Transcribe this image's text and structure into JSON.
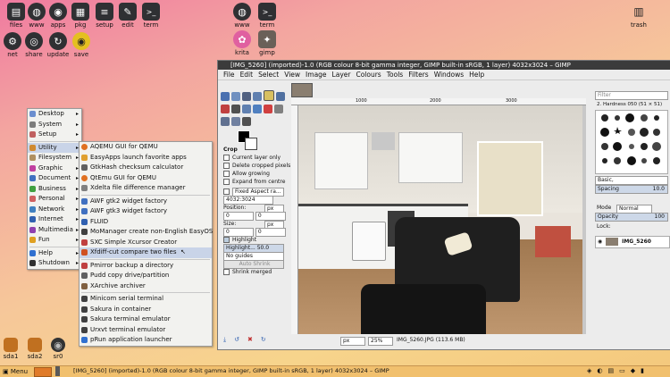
{
  "desktop_icons_top": [
    {
      "label": "files",
      "icon": "files-icon",
      "glyph": "▤"
    },
    {
      "label": "www",
      "icon": "globe-icon",
      "glyph": "◍"
    },
    {
      "label": "apps",
      "icon": "apps-icon",
      "glyph": "◉"
    },
    {
      "label": "pkg",
      "icon": "package-icon",
      "glyph": "▦"
    },
    {
      "label": "setup",
      "icon": "sliders-icon",
      "glyph": "≡"
    },
    {
      "label": "edit",
      "icon": "edit-icon",
      "glyph": "✎"
    },
    {
      "label": "term",
      "icon": "terminal-icon",
      "glyph": ">_"
    }
  ],
  "desktop_icons_row2": [
    {
      "label": "net",
      "icon": "network-icon",
      "glyph": "⚙"
    },
    {
      "label": "share",
      "icon": "share-icon",
      "glyph": "◎"
    },
    {
      "label": "update",
      "icon": "update-icon",
      "glyph": "↻"
    },
    {
      "label": "save",
      "icon": "save-icon",
      "glyph": "◉"
    }
  ],
  "desktop_icons_center": [
    {
      "label": "www",
      "icon": "globe-icon",
      "glyph": "◍"
    },
    {
      "label": "term",
      "icon": "terminal-icon",
      "glyph": ">_"
    },
    {
      "label": "krita",
      "icon": "krita-icon",
      "glyph": "✿"
    },
    {
      "label": "gimp",
      "icon": "gimp-icon",
      "glyph": "✦"
    }
  ],
  "trash": {
    "label": "trash",
    "icon": "trash-icon",
    "glyph": "🗑"
  },
  "drives": [
    {
      "label": "sda1",
      "icon": "drive-icon"
    },
    {
      "label": "sda2",
      "icon": "drive-icon"
    },
    {
      "label": "sr0",
      "icon": "optical-drive-icon"
    }
  ],
  "main_menu": {
    "items": [
      {
        "label": "Desktop",
        "color": "#6b8ecf",
        "sub": true
      },
      {
        "label": "System",
        "color": "#7c7c7c",
        "sub": true
      },
      {
        "label": "Setup",
        "color": "#c06060",
        "sub": true
      },
      {
        "sep": true
      },
      {
        "label": "Utility",
        "color": "#d08a30",
        "sub": true,
        "selected": true
      },
      {
        "label": "Filesystem",
        "color": "#b09060",
        "sub": true
      },
      {
        "label": "Graphic",
        "color": "#c040a0",
        "sub": true
      },
      {
        "label": "Document",
        "color": "#4070c0",
        "sub": true
      },
      {
        "label": "Business",
        "color": "#40a040",
        "sub": true
      },
      {
        "label": "Personal",
        "color": "#d06060",
        "sub": true
      },
      {
        "label": "Network",
        "color": "#4080c0",
        "sub": true
      },
      {
        "label": "Internet",
        "color": "#3060b0",
        "sub": true
      },
      {
        "label": "Multimedia",
        "color": "#9040b0",
        "sub": true
      },
      {
        "label": "Fun",
        "color": "#e0a020",
        "sub": true
      },
      {
        "sep": true
      },
      {
        "label": "Help",
        "color": "#3070d0",
        "sub": true
      },
      {
        "label": "Shutdown",
        "color": "#303030",
        "sub": true
      }
    ]
  },
  "utility_menu": {
    "items": [
      {
        "label": "AQEMU GUI for QEMU",
        "color": "#e07020"
      },
      {
        "label": "EasyApps launch favorite apps",
        "color": "#e0a030"
      },
      {
        "label": "GtkHash checksum calculator",
        "color": "#606060"
      },
      {
        "label": "QtEmu GUI for QEMU",
        "color": "#e07020"
      },
      {
        "label": "Xdelta file difference manager",
        "color": "#808080"
      },
      {
        "sep": true
      },
      {
        "label": "AWF gtk2 widget factory",
        "color": "#4070c0"
      },
      {
        "label": "AWF gtk3 widget factory",
        "color": "#4070c0"
      },
      {
        "label": "FLUID",
        "color": "#3060b0"
      },
      {
        "label": "MoManager create non-English EasyOS",
        "color": "#404040"
      },
      {
        "label": "SXC Simple Xcursor Creator",
        "color": "#c04040"
      },
      {
        "label": "Xfdiff-cut compare two files",
        "color": "#d05020",
        "selected": true
      },
      {
        "sep": true
      },
      {
        "label": "Pmirror backup a directory",
        "color": "#c04040"
      },
      {
        "label": "Pudd copy drive/partition",
        "color": "#606060"
      },
      {
        "label": "XArchive archiver",
        "color": "#806040"
      },
      {
        "sep": true
      },
      {
        "label": "Minicom serial terminal",
        "color": "#404040"
      },
      {
        "label": "Sakura in container",
        "color": "#404040"
      },
      {
        "label": "Sakura terminal emulator",
        "color": "#404040"
      },
      {
        "label": "Urxvt terminal emulator",
        "color": "#404040"
      },
      {
        "label": "pRun application launcher",
        "color": "#3070d0"
      }
    ]
  },
  "gimp": {
    "title": "[IMG_5260] (imported)-1.0 (RGB colour 8-bit gamma integer, GIMP built-in sRGB, 1 layer) 4032x3024 – GIMP",
    "menus": [
      "File",
      "Edit",
      "Select",
      "View",
      "Image",
      "Layer",
      "Colours",
      "Tools",
      "Filters",
      "Windows",
      "Help"
    ],
    "tool_options": {
      "heading": "Crop",
      "checks": [
        "Current layer only",
        "Delete cropped pixels",
        "Allow growing",
        "Expand from centre"
      ],
      "fixed": "Fixed Aspect ra...",
      "ratio": "4032:3024",
      "position_label": "Position:",
      "position_unit": "px",
      "pos_x": "0",
      "pos_y": "0",
      "size_label": "Size:",
      "size_unit": "px",
      "size_w": "0",
      "size_h": "0",
      "highlight": "Highlight",
      "highlight_opacity": "Highlight...",
      "highlight_value": "50.0",
      "guides": "No guides",
      "auto_shrink": "Auto Shrink",
      "shrink_merged": "Shrink merged"
    },
    "ruler_ticks": [
      "1000",
      "2000",
      "3000"
    ],
    "status": {
      "unit": "px",
      "zoom": "25%",
      "file": "IMG_5260.JPG (113.6 MB)"
    },
    "brushes": {
      "filter": "Filter",
      "name": "2. Hardness 050 (51 × 51)",
      "preset": "Basic,",
      "spacing_label": "Spacing",
      "spacing": "10.0"
    },
    "layers": {
      "mode_label": "Mode",
      "mode": "Normal",
      "opacity_label": "Opacity",
      "opacity": "100",
      "lock_label": "Lock:",
      "layer_name": "IMG_5260"
    }
  },
  "taskbar": {
    "menu": "Menu",
    "task": "[IMG_5260] (imported)-1.0 (RGB colour 8-bit gamma integer, GIMP built-in sRGB, 1 layer) 4032x3024 – GIMP"
  }
}
